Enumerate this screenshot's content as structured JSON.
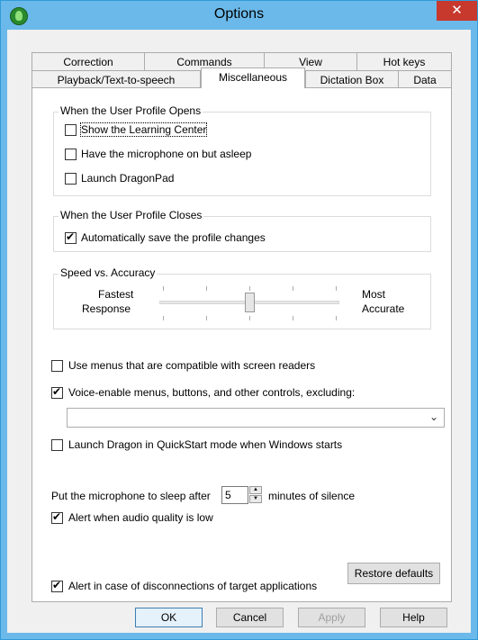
{
  "window": {
    "title": "Options",
    "close_symbol": "✕"
  },
  "tabs_row1": [
    "Correction",
    "Commands",
    "View",
    "Hot keys"
  ],
  "tabs_row2": [
    "Playback/Text-to-speech",
    "Miscellaneous",
    "Dictation Box",
    "Data"
  ],
  "opens_group": {
    "title": "When the User Profile Opens",
    "show_learning_center": {
      "label": "Show the Learning Center",
      "checked": false
    },
    "mic_on_asleep": {
      "label": "Have the microphone on but asleep",
      "checked": false
    },
    "launch_dragonpad": {
      "label": "Launch DragonPad",
      "checked": false
    }
  },
  "closes_group": {
    "title": "When the User Profile Closes",
    "auto_save": {
      "label": "Automatically save the profile changes",
      "checked": true
    }
  },
  "speed_group": {
    "title": "Speed vs. Accuracy",
    "left_label_1": "Fastest",
    "left_label_2": "Response",
    "right_label_1": "Most",
    "right_label_2": "Accurate",
    "level": 0.5
  },
  "screen_readers": {
    "label": "Use menus that are compatible with screen readers",
    "checked": false
  },
  "voice_enable": {
    "label": "Voice-enable menus, buttons, and other controls, excluding:",
    "checked": true
  },
  "exclusion_select": {
    "value": ""
  },
  "quickstart": {
    "label": "Launch Dragon in QuickStart mode when Windows starts",
    "checked": false
  },
  "sleep": {
    "prefix": "Put the microphone to sleep after",
    "value": "5",
    "suffix": "minutes of silence"
  },
  "audio_alert": {
    "label": "Alert when audio quality is low",
    "checked": true
  },
  "disconnect_alert": {
    "label": "Alert in case of disconnections of target applications",
    "checked": true
  },
  "restore_defaults": "Restore defaults",
  "buttons": {
    "ok": "OK",
    "cancel": "Cancel",
    "apply": "Apply",
    "help": "Help"
  }
}
